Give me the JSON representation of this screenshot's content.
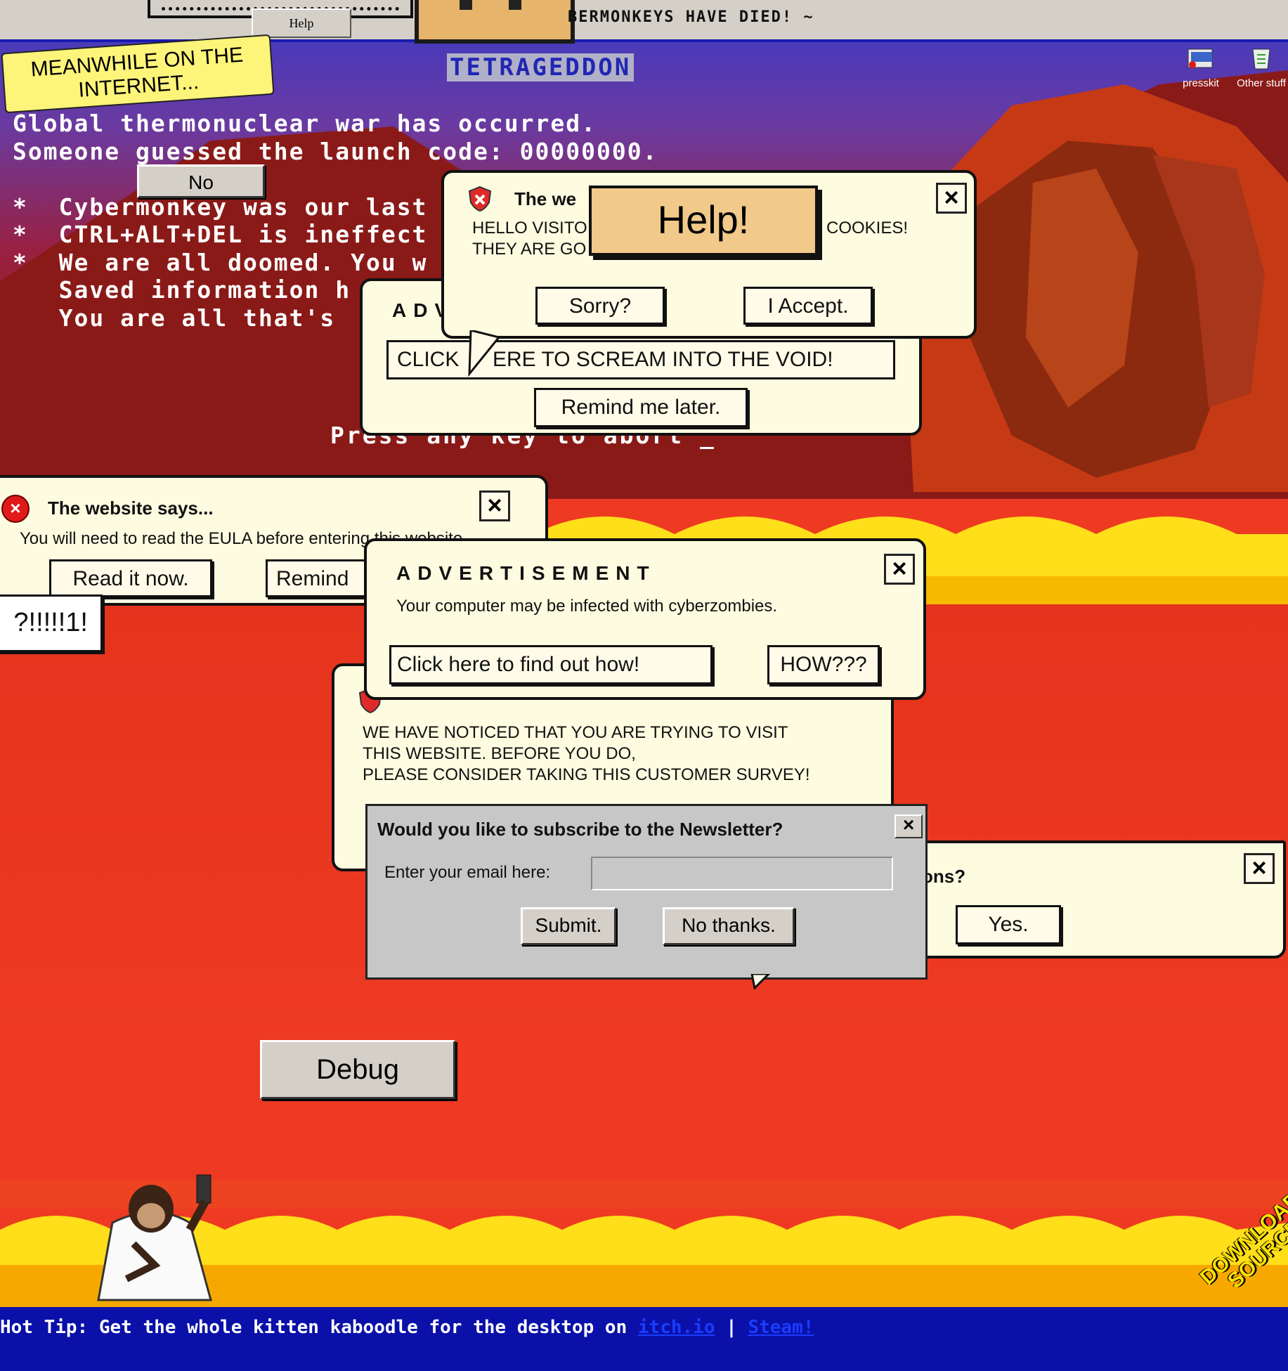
{
  "topbar": {
    "help_label": "Help",
    "marquee": "BERMONKEYS HAVE DIED! ~"
  },
  "sticky_note": "MEANWHILE ON THE\nINTERNET...",
  "bsod": {
    "title": "TETRAGEDDON",
    "lines": "Global thermonuclear war has occurred.\nSomeone guessed the launch code: 00000000.\n\n*  Cybermonkey was our last\n*  CTRL+ALT+DEL is ineffect\n*  We are all doomed. You w\n   Saved information h\n   You are all that's",
    "press_key": "Press any key to abort _",
    "no_button": "No"
  },
  "desktop_icons": [
    {
      "label": "presskit",
      "icon": "folder-icon"
    },
    {
      "label": "Other stuff",
      "icon": "recycle-bin-icon"
    }
  ],
  "dialogs": {
    "cookies": {
      "title": "The we",
      "message_left": "HELLO VISITO\nTHEY ARE GO",
      "message_right": "COOKIES!",
      "sorry": "Sorry?",
      "accept": "I Accept."
    },
    "help_tooltip": "Help!",
    "scream_ad": {
      "title": "ADV",
      "click_label": "CLICK",
      "scream_label": "ERE TO SCREAM INTO THE VOID!",
      "remind": "Remind me later."
    },
    "eula": {
      "title": "The website says...",
      "message": "You will need to read the EULA before entering this website",
      "read_now": "Read it now.",
      "remind": "Remind",
      "partial_button": "?!!!!!1!"
    },
    "cyberzombies": {
      "title": "ADVERTISEMENT",
      "message": "Your computer may be infected with cyberzombies.",
      "find_out": "Click here to find out how!",
      "how": "HOW???"
    },
    "survey": {
      "message": "WE HAVE NOTICED THAT YOU ARE TRYING TO VISIT\nTHIS WEBSITE. BEFORE YOU DO,\nPLEASE CONSIDER TAKING THIS CUSTOMER SURVEY!"
    },
    "newsletter": {
      "title": "Would you like to subscribe to the Newsletter?",
      "email_label": "Enter your email here:",
      "email_value": "",
      "submit": "Submit.",
      "no_thanks": "No thanks."
    },
    "questions": {
      "title_fragment": "ons?",
      "yes": "Yes."
    }
  },
  "debug_label": "Debug",
  "download_badge": "DOWNLOAD\nSOURCE",
  "footer": {
    "tip": "Hot Tip: Get the whole kitten kaboodle for the desktop on ",
    "link1": "itch.io",
    "separator": " | ",
    "link2": "Steam!"
  }
}
